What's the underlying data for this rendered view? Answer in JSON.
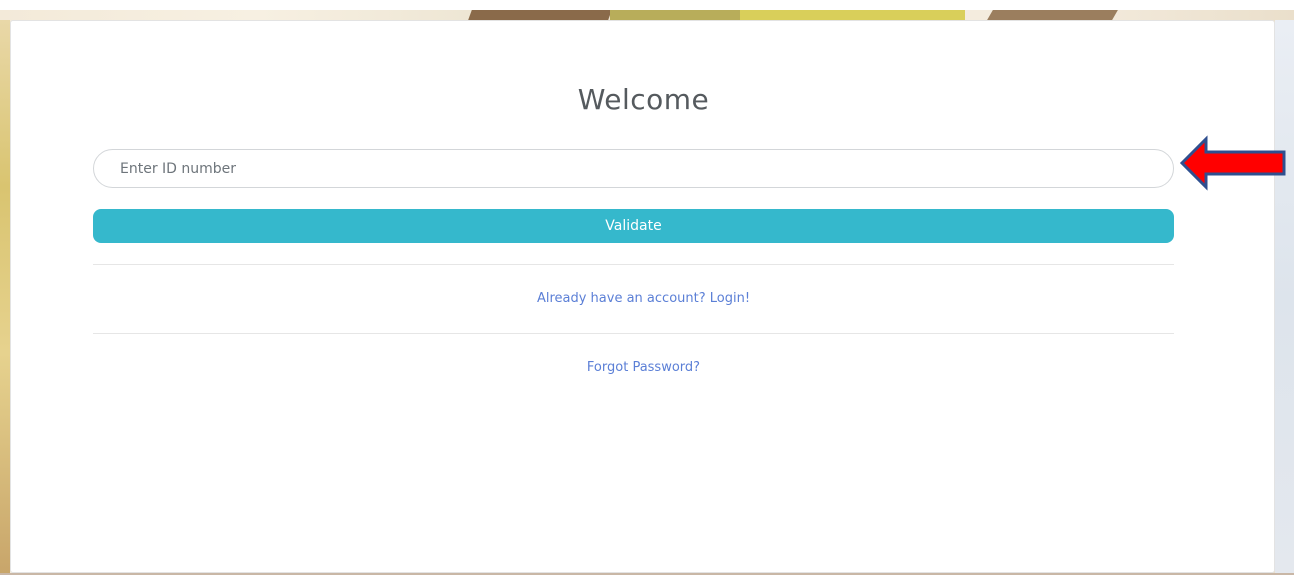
{
  "form": {
    "title": "Welcome",
    "id_input": {
      "placeholder": "Enter ID number",
      "value": ""
    },
    "validate_label": "Validate",
    "login_link": "Already have an account? Login!",
    "forgot_link": "Forgot Password?"
  },
  "colors": {
    "accent": "#35b8cc",
    "link": "#5b7fd6",
    "arrow_fill": "#ff0000",
    "arrow_outline": "#2f4f8f"
  },
  "annotation": {
    "icon": "left-arrow-icon"
  }
}
